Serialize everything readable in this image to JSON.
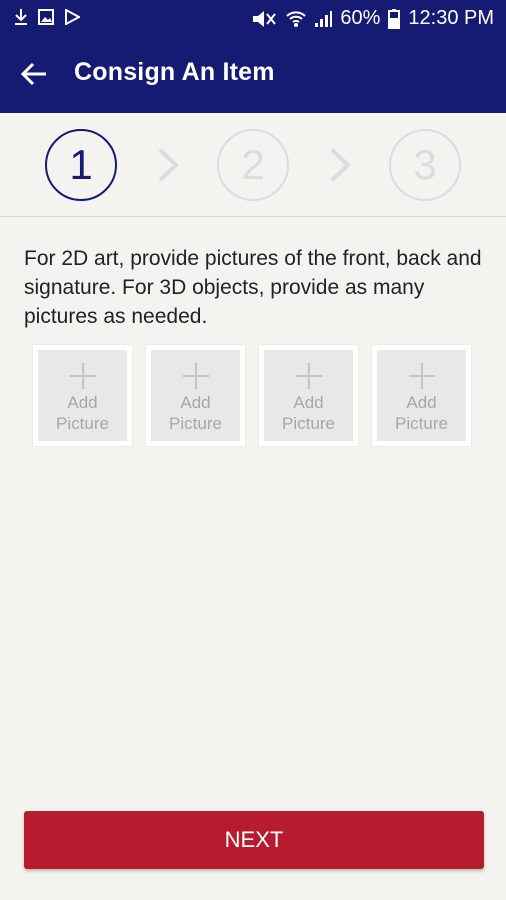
{
  "status_bar": {
    "battery": "60%",
    "time": "12:30 PM",
    "left_icons": [
      "download-icon",
      "image-icon",
      "play-store-icon"
    ],
    "right_icons": [
      "mute-icon",
      "wifi-icon",
      "signal-icon",
      "battery-icon"
    ]
  },
  "app_bar": {
    "title": "Consign An Item",
    "back_icon": "back-arrow-icon"
  },
  "steps": [
    {
      "label": "1",
      "active": true
    },
    {
      "label": "2",
      "active": false
    },
    {
      "label": "3",
      "active": false
    }
  ],
  "instructions": "For 2D art, provide pictures of the front, back and signature. For 3D objects, provide as many pictures as needed.",
  "pictures": [
    {
      "line1": "Add",
      "line2": "Picture"
    },
    {
      "line1": "Add",
      "line2": "Picture"
    },
    {
      "line1": "Add",
      "line2": "Picture"
    },
    {
      "line1": "Add",
      "line2": "Picture"
    }
  ],
  "next_button": "NEXT",
  "colors": {
    "primary": "#151b73",
    "accent": "#b71c2e",
    "background": "#f4f3ef",
    "inactive": "#dcdcdc"
  }
}
